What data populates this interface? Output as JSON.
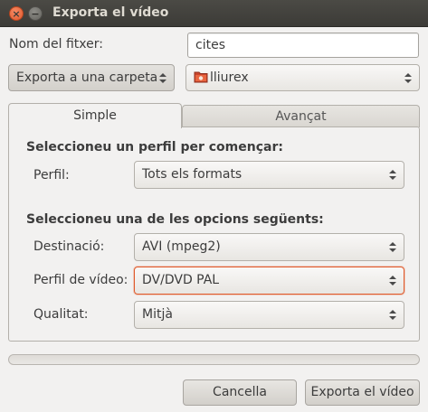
{
  "window": {
    "title": "Exporta el vídeo",
    "close_glyph": "×",
    "minimize_glyph": "−"
  },
  "filename": {
    "label": "Nom del fitxer:",
    "value": "cites"
  },
  "destination_mode": {
    "selected": "Exporta a una carpeta"
  },
  "folder": {
    "selected": "lliurex",
    "icon": "folder-icon"
  },
  "tabs": [
    {
      "label": "Simple",
      "active": true
    },
    {
      "label": "Avançat",
      "active": false
    }
  ],
  "simple": {
    "profile_section": {
      "heading": "Seleccioneu un perfil per començar:",
      "profile_label": "Perfil:",
      "profile_value": "Tots els formats"
    },
    "options_section": {
      "heading": "Seleccioneu una de les opcions següents:",
      "destination_label": "Destinació:",
      "destination_value": "AVI (mpeg2)",
      "video_profile_label": "Perfil de vídeo:",
      "video_profile_value": "DV/DVD PAL",
      "quality_label": "Qualitat:",
      "quality_value": "Mitjà"
    }
  },
  "progress": {
    "fraction": 0
  },
  "buttons": {
    "cancel": "Cancella",
    "export": "Exporta el vídeo"
  },
  "colors": {
    "accent": "#e05a2b",
    "titlebar": "#3c3b37",
    "background": "#f2f1f0"
  }
}
